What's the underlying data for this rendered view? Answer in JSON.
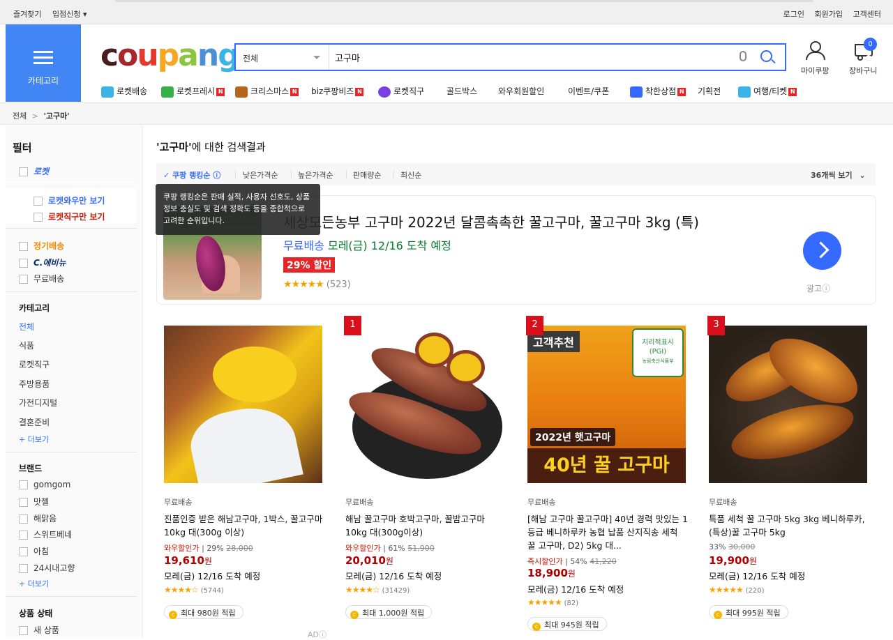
{
  "topbar": {
    "left": [
      "즐겨찾기",
      "입점신청 ▾"
    ],
    "right": [
      "로그인",
      "회원가입",
      "고객센터"
    ]
  },
  "category_button": "카테고리",
  "logo": [
    "c",
    "o",
    "u",
    "p",
    "a",
    "n",
    "g"
  ],
  "search": {
    "category": "전체",
    "query": "고구마"
  },
  "header": {
    "mycoupang": "마이쿠팡",
    "cart": "장바구니",
    "cart_count": "0"
  },
  "nav": [
    {
      "label": "로켓배송",
      "new": false,
      "icon_color": "#3ab3e6"
    },
    {
      "label": "로켓프레시",
      "new": true,
      "icon_color": "#37b04a"
    },
    {
      "label": "크리스마스",
      "new": true,
      "icon_color": "#b5651d"
    },
    {
      "label": "biz쿠팡비즈",
      "new": true,
      "icon_color": ""
    },
    {
      "label": "로켓직구",
      "new": false,
      "icon_color": "#7a3fe4"
    },
    {
      "label": "골드박스",
      "new": false,
      "icon_color": ""
    },
    {
      "label": "와우회원할인",
      "new": false,
      "icon_color": ""
    },
    {
      "label": "이벤트/쿠폰",
      "new": false,
      "icon_color": ""
    },
    {
      "label": "착한상점",
      "new": true,
      "icon_color": "#346aff"
    },
    {
      "label": "기획전",
      "new": false,
      "icon_color": ""
    },
    {
      "label": "여행/티켓",
      "new": true,
      "icon_color": "#3ab3e6"
    }
  ],
  "breadcrumb": {
    "root": "전체",
    "sep": ">",
    "current": "'고구마'"
  },
  "sidebar": {
    "filter_title": "필터",
    "rocket": "로켓",
    "rocket_wow": "로켓와우만 보기",
    "rocket_direct": "로켓직구만 보기",
    "subscription": "정기배송",
    "evenue": "C.에비뉴",
    "free_ship": "무료배송",
    "category_title": "카테고리",
    "categories": [
      "전체",
      "식품",
      "로켓직구",
      "주방용품",
      "가전디지털",
      "결혼준비"
    ],
    "more": "+ 더보기",
    "brand_title": "브랜드",
    "brands": [
      "gomgom",
      "맛젤",
      "해맑음",
      "스위트베네",
      "아침",
      "24시내고향"
    ],
    "brand_more": "+ 더보기",
    "status_title": "상품 상태",
    "status": [
      "새 상품"
    ]
  },
  "results": {
    "query": "'고구마'",
    "suffix": "에 대한 검색결과"
  },
  "sort": {
    "options": [
      "✓ 쿠팡 랭킹순 ⓘ",
      "낮은가격순",
      "높은가격순",
      "판매량순",
      "최신순"
    ],
    "view": "36개씩 보기"
  },
  "tooltip": "쿠팡 랭킹순은 판매 실적, 사용자 선호도, 상품 정보 충실도 및 검색 정확도 등을 종합적으로 고려한 순위입니다.",
  "ad": {
    "title": "세상모든농부 고구마 2022년 달콤촉촉한 꿀고구마, 꿀고구마 3kg (특)",
    "free": "무료배송",
    "delivery": "모레(금) 12/16 도착 예정",
    "discount": "29% 할인",
    "stars": "★★★★★",
    "rating": 4.5,
    "reviews": "(523)",
    "ad_label": "광고ⓘ"
  },
  "products": [
    {
      "rank": "",
      "free": "무료배송",
      "name": "진품인증 받은 해남고구마, 1박스, 꿀고구마 10kg 대(300g 이상)",
      "deal_label": "와우할인가",
      "pct": "29%",
      "orig": "28,000",
      "price": "19,610",
      "won": "원",
      "delivery": "모레(금) 12/16 도착 예정",
      "stars": "★★★★☆",
      "rating": 4,
      "reviews": "(5744)",
      "points": "최대 980원 적립"
    },
    {
      "rank": "1",
      "free": "무료배송",
      "name": "해남 꿀고구마 호박고구마, 꿀밤고구마 10kg 대(300g이상)",
      "deal_label": "와우할인가",
      "pct": "61%",
      "orig": "51,900",
      "price": "20,010",
      "won": "원",
      "delivery": "모레(금) 12/16 도착 예정",
      "stars": "★★★★☆",
      "rating": 4,
      "reviews": "(31429)",
      "points": "최대 1,000원 적립"
    },
    {
      "rank": "2",
      "free": "무료배송",
      "name": "[해남 고구마 꿀고구마] 40년 경력 맛있는 1등급 베니하루카 농협 납품 산지직송 세척 꿀 고구마, D2) 5kg 대...",
      "deal_label": "즉시할인가",
      "pct": "54%",
      "orig": "41,220",
      "price": "18,900",
      "won": "원",
      "delivery": "모레(금) 12/16 도착 예정",
      "stars": "★★★★★",
      "rating": 5,
      "reviews": "(82)",
      "points": "최대 945원 적립"
    },
    {
      "rank": "3",
      "free": "무료배송",
      "name": "특품 세척 꿀 고구마 5kg 3kg 베니하루카, (특상)꿀 고구마 5kg",
      "deal_label": "",
      "pct": "33%",
      "orig": "30,000",
      "price": "19,900",
      "won": "원",
      "delivery": "모레(금) 12/16 도착 예정",
      "stars": "★★★★★",
      "rating": 5,
      "reviews": "(220)",
      "points": "최대 995원 적립"
    }
  ],
  "image_texts": {
    "p3_badge": "고객추천",
    "p3_pgi1": "지리적표시",
    "p3_pgi2": "(PGI)",
    "p3_pgi3": "농림축산식품부",
    "p3_year": "2022년 햇고구마",
    "p3_big": "40년 꿀 고구마"
  },
  "footer_ad": "ADⓘ"
}
